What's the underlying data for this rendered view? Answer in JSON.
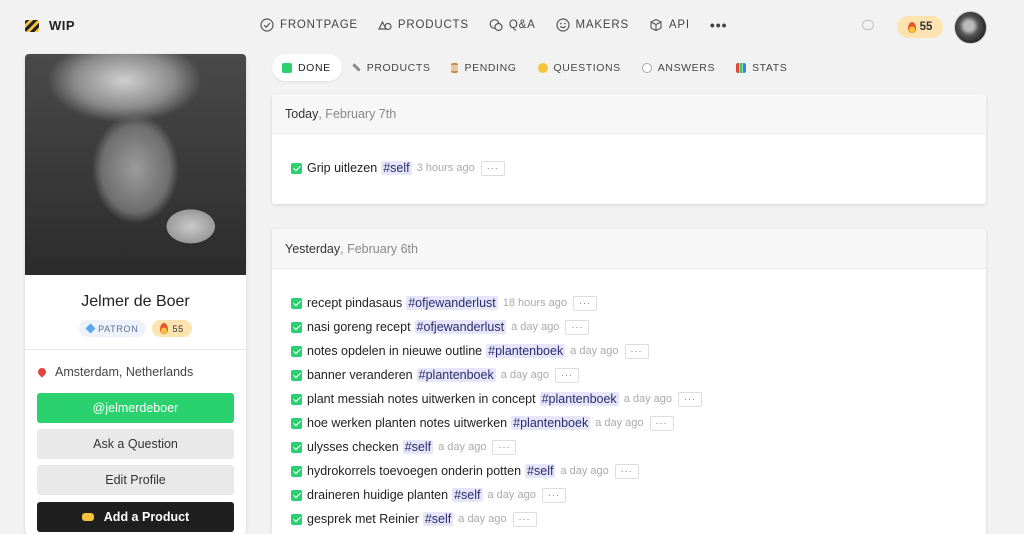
{
  "brand": {
    "name": "WIP"
  },
  "nav": {
    "links": [
      {
        "label": "FRONTPAGE",
        "icon": "check-circle-icon"
      },
      {
        "label": "PRODUCTS",
        "icon": "shapes-icon"
      },
      {
        "label": "Q&A",
        "icon": "chat-bubbles-icon"
      },
      {
        "label": "MAKERS",
        "icon": "smiley-icon"
      },
      {
        "label": "API",
        "icon": "cube-icon"
      }
    ],
    "more": "•••",
    "streak": "55",
    "streak_icon": "flame-icon"
  },
  "profile": {
    "name": "Jelmer de Boer",
    "patron_badge": "PATRON",
    "streak": "55",
    "location": "Amsterdam, Netherlands",
    "handle_button": "@jelmerdeboer",
    "ask_button": "Ask a Question",
    "edit_button": "Edit Profile",
    "add_button": "Add a Product"
  },
  "tabs": [
    {
      "label": "DONE",
      "active": true,
      "icon": "check-box-icon"
    },
    {
      "label": "PRODUCTS",
      "active": false,
      "icon": "hammer-wrench-icon"
    },
    {
      "label": "PENDING",
      "active": false,
      "icon": "hourglass-icon"
    },
    {
      "label": "QUESTIONS",
      "active": false,
      "icon": "thinking-face-icon"
    },
    {
      "label": "ANSWERS",
      "active": false,
      "icon": "speech-bubble-icon"
    },
    {
      "label": "STATS",
      "active": false,
      "icon": "bar-chart-icon"
    }
  ],
  "days": [
    {
      "label": "Today",
      "date": ", February 7th",
      "todos": [
        {
          "text": "Grip uitlezen",
          "tag": "#self",
          "time": "3 hours ago"
        }
      ]
    },
    {
      "label": "Yesterday",
      "date": ", February 6th",
      "todos": [
        {
          "text": "recept pindasaus",
          "tag": "#ofjewanderlust",
          "time": "18 hours ago"
        },
        {
          "text": "nasi goreng recept",
          "tag": "#ofjewanderlust",
          "time": "a day ago"
        },
        {
          "text": "notes opdelen in nieuwe outline",
          "tag": "#plantenboek",
          "time": "a day ago"
        },
        {
          "text": "banner veranderen",
          "tag": "#plantenboek",
          "time": "a day ago"
        },
        {
          "text": "plant messiah notes uitwerken in concept",
          "tag": "#plantenboek",
          "time": "a day ago"
        },
        {
          "text": "hoe werken planten notes uitwerken",
          "tag": "#plantenboek",
          "time": "a day ago"
        },
        {
          "text": "ulysses checken",
          "tag": "#self",
          "time": "a day ago"
        },
        {
          "text": "hydrokorrels toevoegen onderin potten",
          "tag": "#self",
          "time": "a day ago"
        },
        {
          "text": "draineren huidige planten",
          "tag": "#self",
          "time": "a day ago"
        },
        {
          "text": "gesprek met Reinier",
          "tag": "#self",
          "time": "a day ago"
        }
      ]
    }
  ],
  "more_label": "···"
}
